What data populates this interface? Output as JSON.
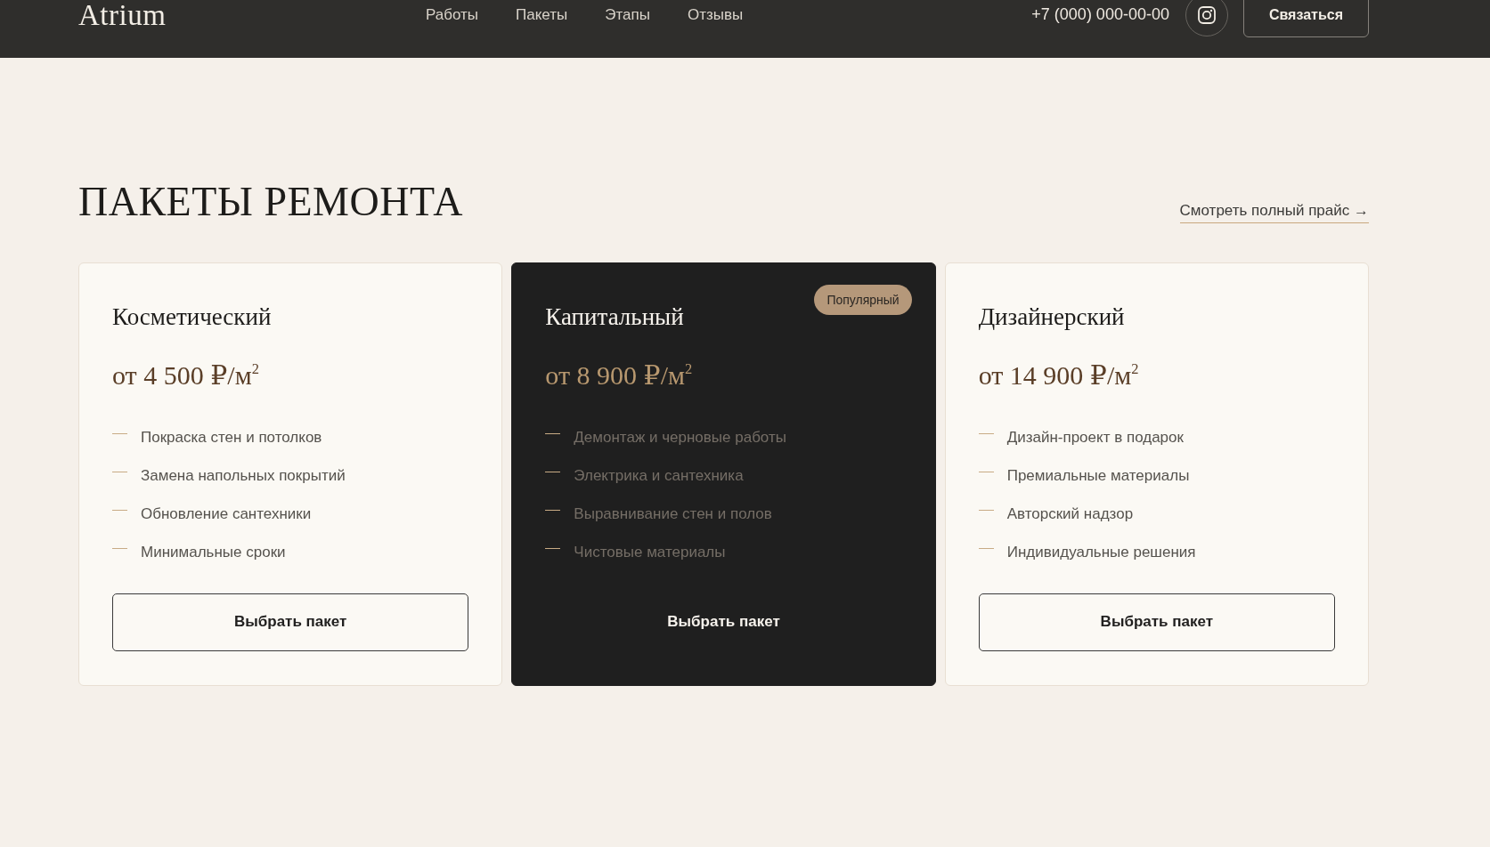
{
  "header": {
    "logo": "Atrium",
    "nav": [
      "Работы",
      "Пакеты",
      "Этапы",
      "Отзывы"
    ],
    "phone": "+7 (000) 000-00-00",
    "contact_button": "Связаться"
  },
  "section": {
    "title": "ПАКЕТЫ РЕМОНТА",
    "price_link": "Смотреть полный прайс →"
  },
  "packages": [
    {
      "name": "Косметический",
      "price": "от 4 500 ₽/м$^{2}$",
      "featured": false,
      "features": [
        "Покраска стен и потолков",
        "Замена напольных покрытий",
        "Обновление сантехники",
        "Минимальные сроки"
      ],
      "button": "Выбрать пакет"
    },
    {
      "name": "Капитальный",
      "badge": "Популярный",
      "price": "от 8 900 ₽/м$^{2}$",
      "featured": true,
      "features": [
        "Демонтаж и черновые работы",
        "Электрика и сантехника",
        "Выравнивание стен и полов",
        "Чистовые материалы"
      ],
      "button": "Выбрать пакет"
    },
    {
      "name": "Дизайнерский",
      "price": "от 14 900 ₽/м$^{2}$",
      "featured": false,
      "features": [
        "Дизайн-проект в подарок",
        "Премиальные материалы",
        "Авторский надзор",
        "Индивидуальные решения"
      ],
      "button": "Выбрать пакет"
    }
  ]
}
